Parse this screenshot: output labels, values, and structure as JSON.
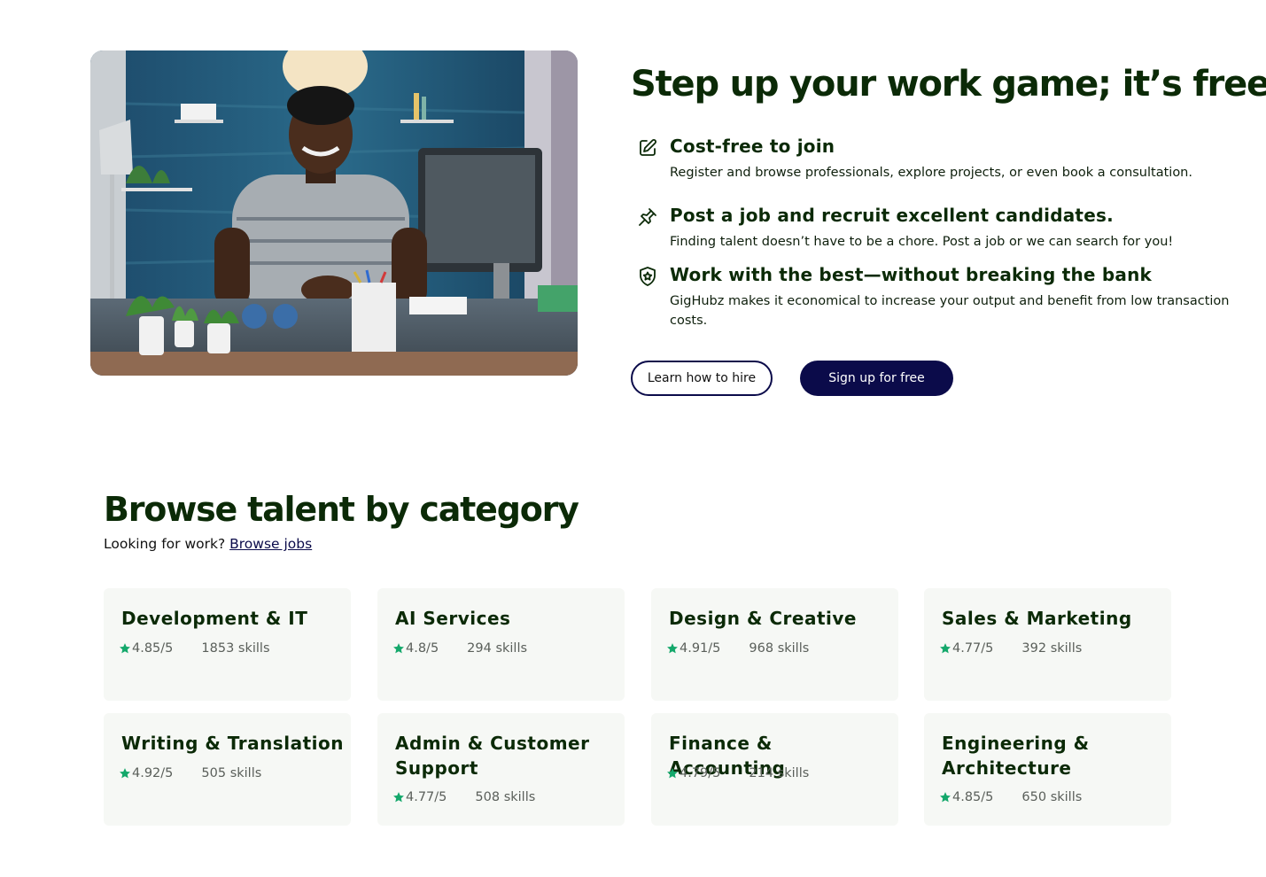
{
  "hero": {
    "title": "Step up your work game; it’s free.",
    "features": [
      {
        "icon": "edit-icon",
        "title": "Cost-free to join",
        "desc": "Register and browse professionals, explore projects, or even book a consultation."
      },
      {
        "icon": "pin-icon",
        "title": "Post a job and recruit excellent candidates.",
        "desc": "Finding talent doesn’t have to be a chore. Post a job or we can search for you!"
      },
      {
        "icon": "award-shield-icon",
        "title": "Work with the best—without breaking the bank",
        "desc": "GigHubz makes it economical to increase your output and benefit from low transaction costs."
      }
    ],
    "buttons": {
      "learn": "Learn how to hire",
      "signup": "Sign up for free"
    }
  },
  "categories": {
    "title": "Browse talent by category",
    "subtitle_prefix": "Looking for work?",
    "subtitle_link": "Browse jobs",
    "items": [
      {
        "name": "Development & IT",
        "rating": "4.85/5",
        "skills": "1853 skills"
      },
      {
        "name": "AI Services",
        "rating": "4.8/5",
        "skills": "294 skills"
      },
      {
        "name": "Design & Creative",
        "rating": "4.91/5",
        "skills": "968 skills"
      },
      {
        "name": "Sales & Marketing",
        "rating": "4.77/5",
        "skills": "392 skills"
      },
      {
        "name": "Writing & Translation",
        "rating": "4.92/5",
        "skills": "505 skills"
      },
      {
        "name": "Admin & Customer Support",
        "rating": "4.77/5",
        "skills": "508 skills"
      },
      {
        "name": "Finance & Accounting",
        "rating": "4.79/5",
        "skills": "214 skills"
      },
      {
        "name": "Engineering & Architecture",
        "rating": "4.85/5",
        "skills": "650 skills"
      }
    ]
  },
  "colors": {
    "brand_navy": "#0b0b4a",
    "heading_green": "#0b2a07",
    "star_green": "#14a86b",
    "card_bg": "#f6f8f5"
  }
}
